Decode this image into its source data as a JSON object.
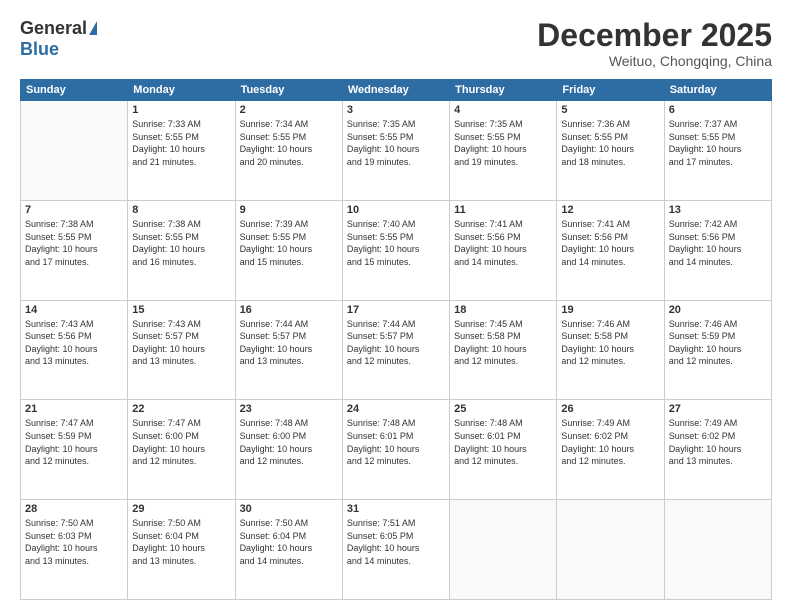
{
  "logo": {
    "general": "General",
    "blue": "Blue"
  },
  "header": {
    "month": "December 2025",
    "location": "Weituo, Chongqing, China"
  },
  "weekdays": [
    "Sunday",
    "Monday",
    "Tuesday",
    "Wednesday",
    "Thursday",
    "Friday",
    "Saturday"
  ],
  "weeks": [
    [
      {
        "day": "",
        "info": ""
      },
      {
        "day": "1",
        "info": "Sunrise: 7:33 AM\nSunset: 5:55 PM\nDaylight: 10 hours\nand 21 minutes."
      },
      {
        "day": "2",
        "info": "Sunrise: 7:34 AM\nSunset: 5:55 PM\nDaylight: 10 hours\nand 20 minutes."
      },
      {
        "day": "3",
        "info": "Sunrise: 7:35 AM\nSunset: 5:55 PM\nDaylight: 10 hours\nand 19 minutes."
      },
      {
        "day": "4",
        "info": "Sunrise: 7:35 AM\nSunset: 5:55 PM\nDaylight: 10 hours\nand 19 minutes."
      },
      {
        "day": "5",
        "info": "Sunrise: 7:36 AM\nSunset: 5:55 PM\nDaylight: 10 hours\nand 18 minutes."
      },
      {
        "day": "6",
        "info": "Sunrise: 7:37 AM\nSunset: 5:55 PM\nDaylight: 10 hours\nand 17 minutes."
      }
    ],
    [
      {
        "day": "7",
        "info": "Sunrise: 7:38 AM\nSunset: 5:55 PM\nDaylight: 10 hours\nand 17 minutes."
      },
      {
        "day": "8",
        "info": "Sunrise: 7:38 AM\nSunset: 5:55 PM\nDaylight: 10 hours\nand 16 minutes."
      },
      {
        "day": "9",
        "info": "Sunrise: 7:39 AM\nSunset: 5:55 PM\nDaylight: 10 hours\nand 15 minutes."
      },
      {
        "day": "10",
        "info": "Sunrise: 7:40 AM\nSunset: 5:55 PM\nDaylight: 10 hours\nand 15 minutes."
      },
      {
        "day": "11",
        "info": "Sunrise: 7:41 AM\nSunset: 5:56 PM\nDaylight: 10 hours\nand 14 minutes."
      },
      {
        "day": "12",
        "info": "Sunrise: 7:41 AM\nSunset: 5:56 PM\nDaylight: 10 hours\nand 14 minutes."
      },
      {
        "day": "13",
        "info": "Sunrise: 7:42 AM\nSunset: 5:56 PM\nDaylight: 10 hours\nand 14 minutes."
      }
    ],
    [
      {
        "day": "14",
        "info": "Sunrise: 7:43 AM\nSunset: 5:56 PM\nDaylight: 10 hours\nand 13 minutes."
      },
      {
        "day": "15",
        "info": "Sunrise: 7:43 AM\nSunset: 5:57 PM\nDaylight: 10 hours\nand 13 minutes."
      },
      {
        "day": "16",
        "info": "Sunrise: 7:44 AM\nSunset: 5:57 PM\nDaylight: 10 hours\nand 13 minutes."
      },
      {
        "day": "17",
        "info": "Sunrise: 7:44 AM\nSunset: 5:57 PM\nDaylight: 10 hours\nand 12 minutes."
      },
      {
        "day": "18",
        "info": "Sunrise: 7:45 AM\nSunset: 5:58 PM\nDaylight: 10 hours\nand 12 minutes."
      },
      {
        "day": "19",
        "info": "Sunrise: 7:46 AM\nSunset: 5:58 PM\nDaylight: 10 hours\nand 12 minutes."
      },
      {
        "day": "20",
        "info": "Sunrise: 7:46 AM\nSunset: 5:59 PM\nDaylight: 10 hours\nand 12 minutes."
      }
    ],
    [
      {
        "day": "21",
        "info": "Sunrise: 7:47 AM\nSunset: 5:59 PM\nDaylight: 10 hours\nand 12 minutes."
      },
      {
        "day": "22",
        "info": "Sunrise: 7:47 AM\nSunset: 6:00 PM\nDaylight: 10 hours\nand 12 minutes."
      },
      {
        "day": "23",
        "info": "Sunrise: 7:48 AM\nSunset: 6:00 PM\nDaylight: 10 hours\nand 12 minutes."
      },
      {
        "day": "24",
        "info": "Sunrise: 7:48 AM\nSunset: 6:01 PM\nDaylight: 10 hours\nand 12 minutes."
      },
      {
        "day": "25",
        "info": "Sunrise: 7:48 AM\nSunset: 6:01 PM\nDaylight: 10 hours\nand 12 minutes."
      },
      {
        "day": "26",
        "info": "Sunrise: 7:49 AM\nSunset: 6:02 PM\nDaylight: 10 hours\nand 12 minutes."
      },
      {
        "day": "27",
        "info": "Sunrise: 7:49 AM\nSunset: 6:02 PM\nDaylight: 10 hours\nand 13 minutes."
      }
    ],
    [
      {
        "day": "28",
        "info": "Sunrise: 7:50 AM\nSunset: 6:03 PM\nDaylight: 10 hours\nand 13 minutes."
      },
      {
        "day": "29",
        "info": "Sunrise: 7:50 AM\nSunset: 6:04 PM\nDaylight: 10 hours\nand 13 minutes."
      },
      {
        "day": "30",
        "info": "Sunrise: 7:50 AM\nSunset: 6:04 PM\nDaylight: 10 hours\nand 14 minutes."
      },
      {
        "day": "31",
        "info": "Sunrise: 7:51 AM\nSunset: 6:05 PM\nDaylight: 10 hours\nand 14 minutes."
      },
      {
        "day": "",
        "info": ""
      },
      {
        "day": "",
        "info": ""
      },
      {
        "day": "",
        "info": ""
      }
    ]
  ]
}
